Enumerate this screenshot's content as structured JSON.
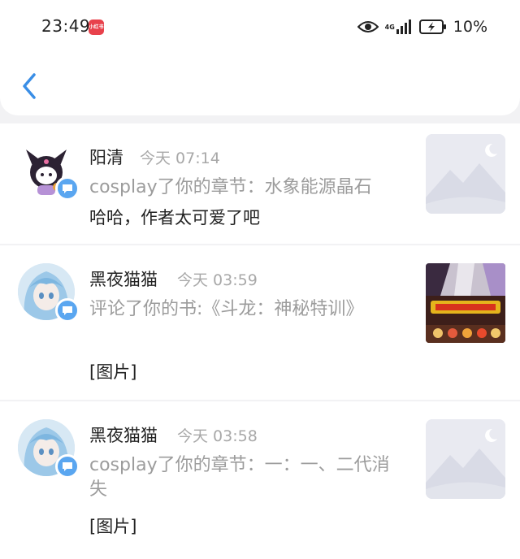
{
  "status_bar": {
    "time": "23:49",
    "app_badge": "小红书",
    "network": "4G",
    "battery": "10%"
  },
  "header": {
    "back_icon": "chevron-left-icon"
  },
  "notifications": [
    {
      "user": "阳清",
      "time": "今天 07:14",
      "action": "cosplay了你的章节：水象能源晶石",
      "content": "哈哈，作者太可爱了吧",
      "avatar_icon": "kuromi-avatar",
      "badge_icon": "comment-bubble-icon",
      "thumbnail": "placeholder-image"
    },
    {
      "user": "黑夜猫猫",
      "time": "今天 03:59",
      "action": "评论了你的书:《斗龙：神秘特训》",
      "content": "[图片]",
      "avatar_icon": "anime-girl-avatar",
      "badge_icon": "comment-bubble-icon",
      "thumbnail": "book-cover"
    },
    {
      "user": "黑夜猫猫",
      "time": "今天 03:58",
      "action": "cosplay了你的章节：一：一、二代消失",
      "content": "[图片]",
      "avatar_icon": "anime-girl-avatar",
      "badge_icon": "comment-bubble-icon",
      "thumbnail": "placeholder-image"
    }
  ],
  "colors": {
    "accent": "#5aa6f0",
    "background": "#f2f2f4",
    "muted_text": "#9c9c9c"
  }
}
